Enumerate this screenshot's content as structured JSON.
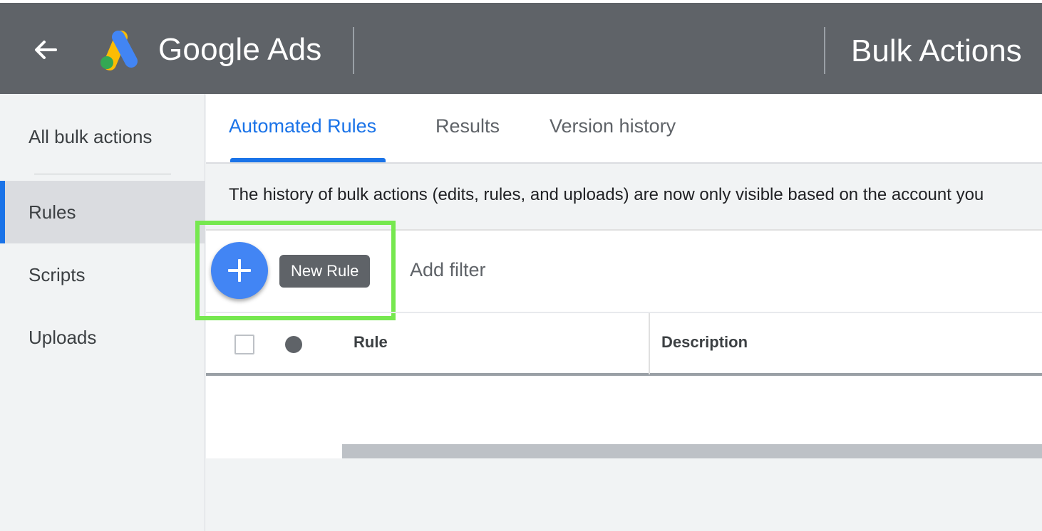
{
  "header": {
    "brand": "Google Ads",
    "page_title": "Bulk Actions",
    "back_icon": "arrow-left-icon",
    "logo_icon": "google-ads-logo-icon"
  },
  "sidebar": {
    "items": [
      {
        "label": "All bulk actions"
      },
      {
        "label": "Rules",
        "active": true
      },
      {
        "label": "Scripts"
      },
      {
        "label": "Uploads"
      }
    ]
  },
  "tabs": [
    {
      "label": "Automated Rules",
      "active": true
    },
    {
      "label": "Results"
    },
    {
      "label": "Version history"
    }
  ],
  "notice": "The history of bulk actions (edits, rules, and uploads) are now only visible based on the account you",
  "toolbar": {
    "fab_icon": "plus-icon",
    "tooltip": "New Rule",
    "add_filter": "Add filter"
  },
  "table": {
    "columns": [
      "Rule",
      "Description"
    ]
  },
  "colors": {
    "accent": "#1a73e8",
    "fab": "#4285f4",
    "highlight": "#76e84f",
    "header_bg": "#5f6368"
  }
}
